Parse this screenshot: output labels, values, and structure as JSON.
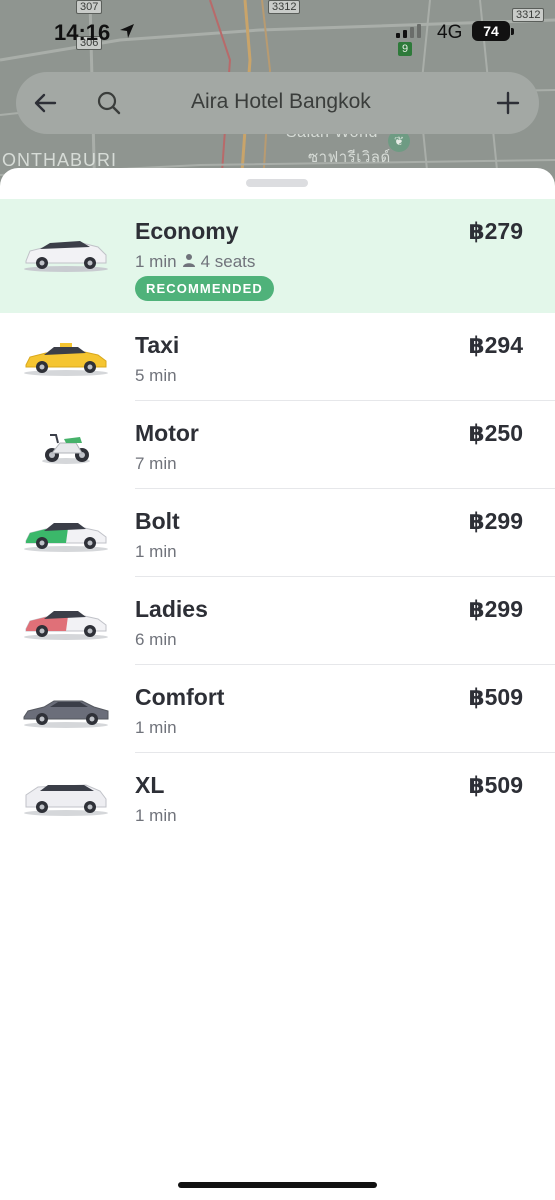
{
  "status_bar": {
    "time": "14:16",
    "network": "4G",
    "battery": "74"
  },
  "map": {
    "area_label": "ONTHABURI",
    "place_name_en": "Salah Wond",
    "place_name_th": "ซาฟารีเวิลด์",
    "road_shields": [
      "3312",
      "3312",
      "307",
      "306"
    ],
    "route_marker": "9"
  },
  "search": {
    "query": "Aira Hotel Bangkok",
    "back_icon": "arrow-left-icon",
    "search_icon": "magnifier-icon",
    "add_icon": "plus-icon"
  },
  "ride_options": [
    {
      "name": "Economy",
      "eta": "1 min",
      "seats": "4 seats",
      "price": "฿279",
      "badge": "RECOMMENDED",
      "selected": true,
      "vehicle_icon": "economy-car-icon",
      "vehicle_color": "#f2f2f5"
    },
    {
      "name": "Taxi",
      "eta": "5 min",
      "price": "฿294",
      "vehicle_icon": "taxi-car-icon",
      "vehicle_color": "#f5c531"
    },
    {
      "name": "Motor",
      "eta": "7 min",
      "price": "฿250",
      "vehicle_icon": "motorbike-icon",
      "vehicle_color": "#46b26a"
    },
    {
      "name": "Bolt",
      "eta": "1 min",
      "price": "฿299",
      "vehicle_icon": "bolt-car-icon",
      "vehicle_color": "#3bb86a"
    },
    {
      "name": "Ladies",
      "eta": "6 min",
      "price": "฿299",
      "vehicle_icon": "ladies-car-icon",
      "vehicle_color": "#e07078"
    },
    {
      "name": "Comfort",
      "eta": "1 min",
      "price": "฿509",
      "vehicle_icon": "comfort-car-icon",
      "vehicle_color": "#6b6e7a"
    },
    {
      "name": "XL",
      "eta": "1 min",
      "price": "฿509",
      "vehicle_icon": "xl-van-icon",
      "vehicle_color": "#eeeef2"
    }
  ],
  "colors": {
    "accent_green": "#4fb27a",
    "selected_row_bg": "#e3f7ea",
    "text_primary": "#2d2f36",
    "text_secondary": "#70737b"
  }
}
